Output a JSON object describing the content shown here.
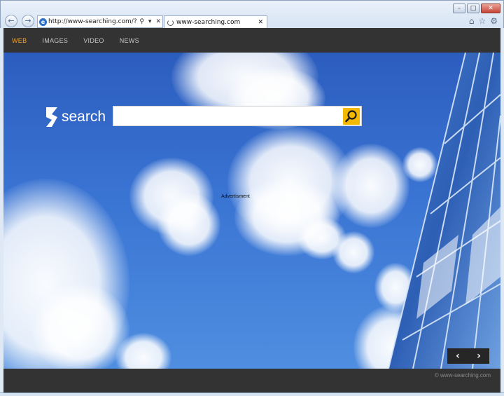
{
  "browser": {
    "url": "http://www-searching.com/?prd=set",
    "tab_title": "www-searching.com",
    "window_buttons": [
      "–",
      "□",
      "✕"
    ],
    "back_glyph": "←",
    "forward_glyph": "→",
    "ie_glyph": "e",
    "search_glyph": "⚲",
    "dropdown_glyph": "▾",
    "close_glyph": "✕",
    "tools": [
      "⌂",
      "☆",
      "⚙"
    ]
  },
  "nav": {
    "items": [
      {
        "label": "WEB",
        "active": true
      },
      {
        "label": "IMAGES",
        "active": false
      },
      {
        "label": "VIDEO",
        "active": false
      },
      {
        "label": "NEWS",
        "active": false
      }
    ]
  },
  "brand": {
    "logo_text": "search"
  },
  "search": {
    "value": "",
    "placeholder": ""
  },
  "ad": {
    "label": "Advertisment"
  },
  "carousel": {
    "prev_glyph": "‹",
    "next_glyph": "›"
  },
  "footer": {
    "copyright": "© www-searching.com"
  },
  "colors": {
    "accent": "#f0a030",
    "search_button": "#f5b800",
    "bar": "#333333"
  }
}
